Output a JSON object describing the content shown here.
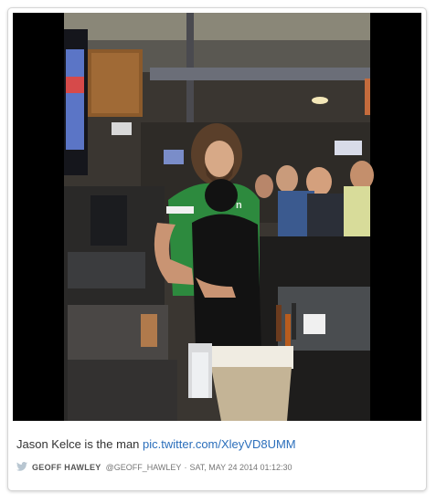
{
  "tweet": {
    "text": "Jason Kelce is the man ",
    "link_text": "pic.twitter.com/XleyVD8UMM",
    "author_name": "GEOFF HAWLEY",
    "author_handle": "@GEOFF_HAWLEY",
    "separator": "·",
    "timestamp": "SAT, MAY 24 2014 01:12:30"
  },
  "icons": {
    "source": "twitter-bird-icon"
  },
  "colors": {
    "link": "#2a6ebb",
    "meta": "#777777",
    "frame": "#000000"
  }
}
